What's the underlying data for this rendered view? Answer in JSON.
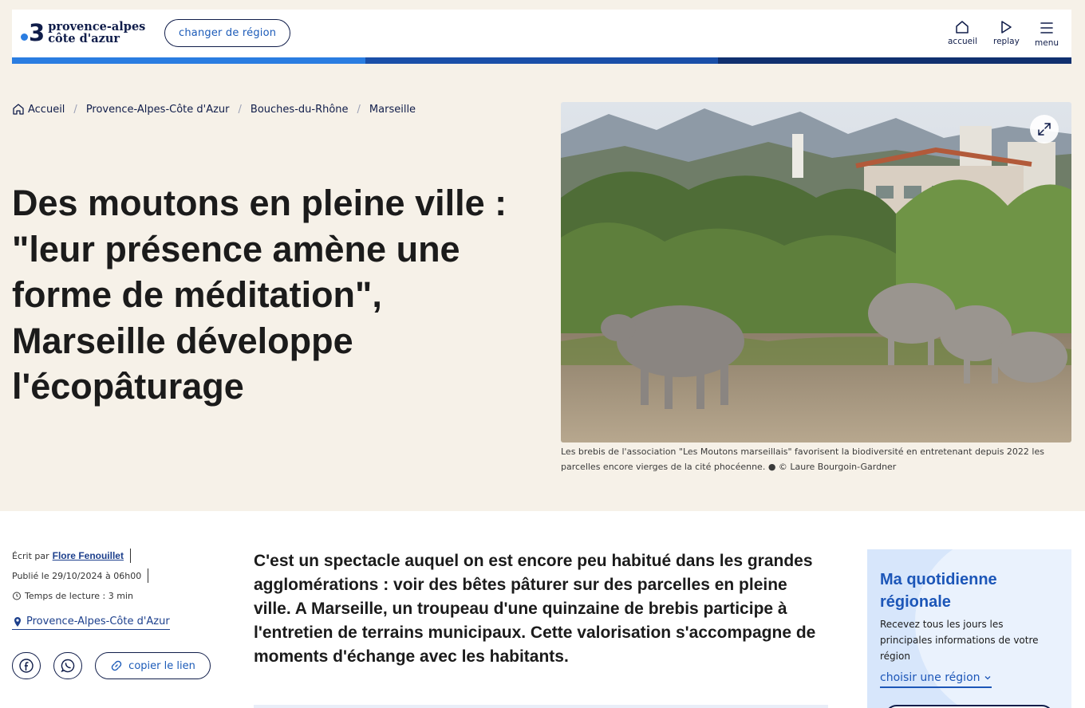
{
  "colors": {
    "page_bg": "#f6f1e8",
    "brand_navy": "#101d4a",
    "brand_blue": "#1c56b8",
    "bar_segments": [
      "#2a7de1",
      "#1a4fa8",
      "#10306f"
    ]
  },
  "header": {
    "logo": {
      "numeral": "3",
      "line1": "provence-alpes",
      "line2": "côte d'azur"
    },
    "change_region_label": "changer de région",
    "nav": [
      {
        "label": "accueil",
        "icon": "home-icon"
      },
      {
        "label": "replay",
        "icon": "play-icon"
      },
      {
        "label": "menu",
        "icon": "hamburger-icon"
      }
    ]
  },
  "breadcrumb": [
    {
      "label": "Accueil"
    },
    {
      "label": "Provence-Alpes-Côte d'Azur"
    },
    {
      "label": "Bouches-du-Rhône"
    },
    {
      "label": "Marseille"
    }
  ],
  "article": {
    "title": "Des moutons en pleine ville : \"leur présence amène une forme de méditation\", Marseille développe l'écopâturage",
    "caption": "Les brebis de l'association \"Les Moutons marseillais\" favorisent la biodiversité en entretenant depuis 2022 les parcelles encore vierges de la cité phocéenne. ● © Laure Bourgoin-Gardner",
    "lead": "C'est un spectacle auquel on est encore peu habitué dans les grandes agglomérations : voir des bêtes pâturer sur des parcelles en pleine ville. A Marseille, un troupeau d'une quinzaine de brebis participe à l'entretien de terrains municipaux. Cette valorisation s'accompagne de moments d'échange avec les habitants."
  },
  "meta": {
    "written_by_label": "Écrit par",
    "author": "Flore Fenouillet",
    "published": "Publié le 29/10/2024 à 06h00",
    "reading_time": "Temps de lecture : 3 min",
    "location": "Provence-Alpes-Côte d'Azur"
  },
  "share": {
    "facebook_icon": "facebook-icon",
    "whatsapp_icon": "whatsapp-icon",
    "copy_link_label": "copier le lien"
  },
  "newsletter": {
    "title": "Ma quotidienne régionale",
    "text": "Recevez tous les jours les principales informations de votre région",
    "select_label": "choisir une région"
  }
}
